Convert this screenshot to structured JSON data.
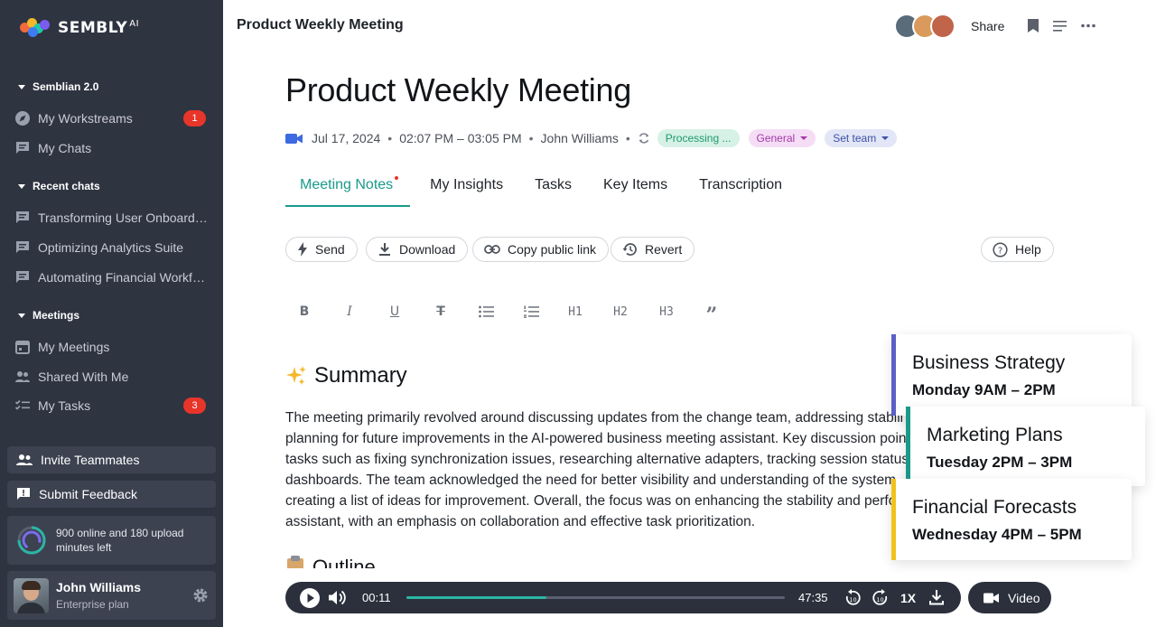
{
  "brand": {
    "name": "SEMBLY",
    "suffix": "AI"
  },
  "sidebar": {
    "section_semblian": "Semblian 2.0",
    "workstreams": {
      "label": "My Workstreams",
      "badge": "1"
    },
    "chats": {
      "label": "My Chats"
    },
    "section_recent": "Recent chats",
    "recent": [
      "Transforming User Onboarding",
      "Optimizing Analytics Suite",
      "Automating Financial Workflo..."
    ],
    "section_meetings": "Meetings",
    "meetings": {
      "label": "My Meetings"
    },
    "shared": {
      "label": "Shared With Me"
    },
    "tasks": {
      "label": "My Tasks",
      "badge": "3"
    },
    "invite": "Invite Teammates",
    "feedback": "Submit Feedback",
    "usage": "900 online and 180 upload minutes left",
    "user": {
      "name": "John Williams",
      "plan": "Enterprise plan"
    }
  },
  "topbar": {
    "title": "Product Weekly Meeting",
    "share": "Share"
  },
  "meeting": {
    "title": "Product Weekly Meeting",
    "date": "Jul 17, 2024",
    "time": "02:07 PM – 03:05 PM",
    "owner": "John Williams",
    "status": "Processing ...",
    "tag": "General",
    "team": "Set team"
  },
  "tabs": [
    "Meeting Notes",
    "My Insights",
    "Tasks",
    "Key Items",
    "Transcription"
  ],
  "actions": {
    "send": "Send",
    "download": "Download",
    "copy": "Copy public link",
    "revert": "Revert",
    "help": "Help"
  },
  "format": {
    "h1": "H1",
    "h2": "H2",
    "h3": "H3"
  },
  "notes": {
    "summary_title": "Summary",
    "summary_lines": [
      "The meeting primarily revolved around discussing updates from the change team, addressing stabili",
      "planning for future improvements in the AI-powered business meeting assistant. Key discussion poin",
      "tasks such as fixing synchronization issues, researching alternative adapters, tracking session status",
      "dashboards. The team acknowledged the need for better visibility and understanding of the system",
      "creating a list of ideas for improvement. Overall, the focus was on enhancing the stability and perfo",
      "assistant, with an emphasis on collaboration and effective task prioritization."
    ],
    "outline_title": "Outline"
  },
  "cards": [
    {
      "title": "Business Strategy",
      "time": "Monday 9AM – 2PM",
      "color": "#5b5fc7"
    },
    {
      "title": "Marketing Plans",
      "time": "Tuesday 2PM – 3PM",
      "color": "#1a9a8a"
    },
    {
      "title": "Financial Forecasts",
      "time": "Wednesday 4PM – 5PM",
      "color": "#f2c21b"
    }
  ],
  "player": {
    "current": "00:11",
    "total": "47:35",
    "progress": 0.37,
    "speed": "1X",
    "video": "Video"
  },
  "colors": {
    "accent": "#1a9a8a",
    "sidebar": "#2f3441",
    "badge": "#e8352a"
  }
}
